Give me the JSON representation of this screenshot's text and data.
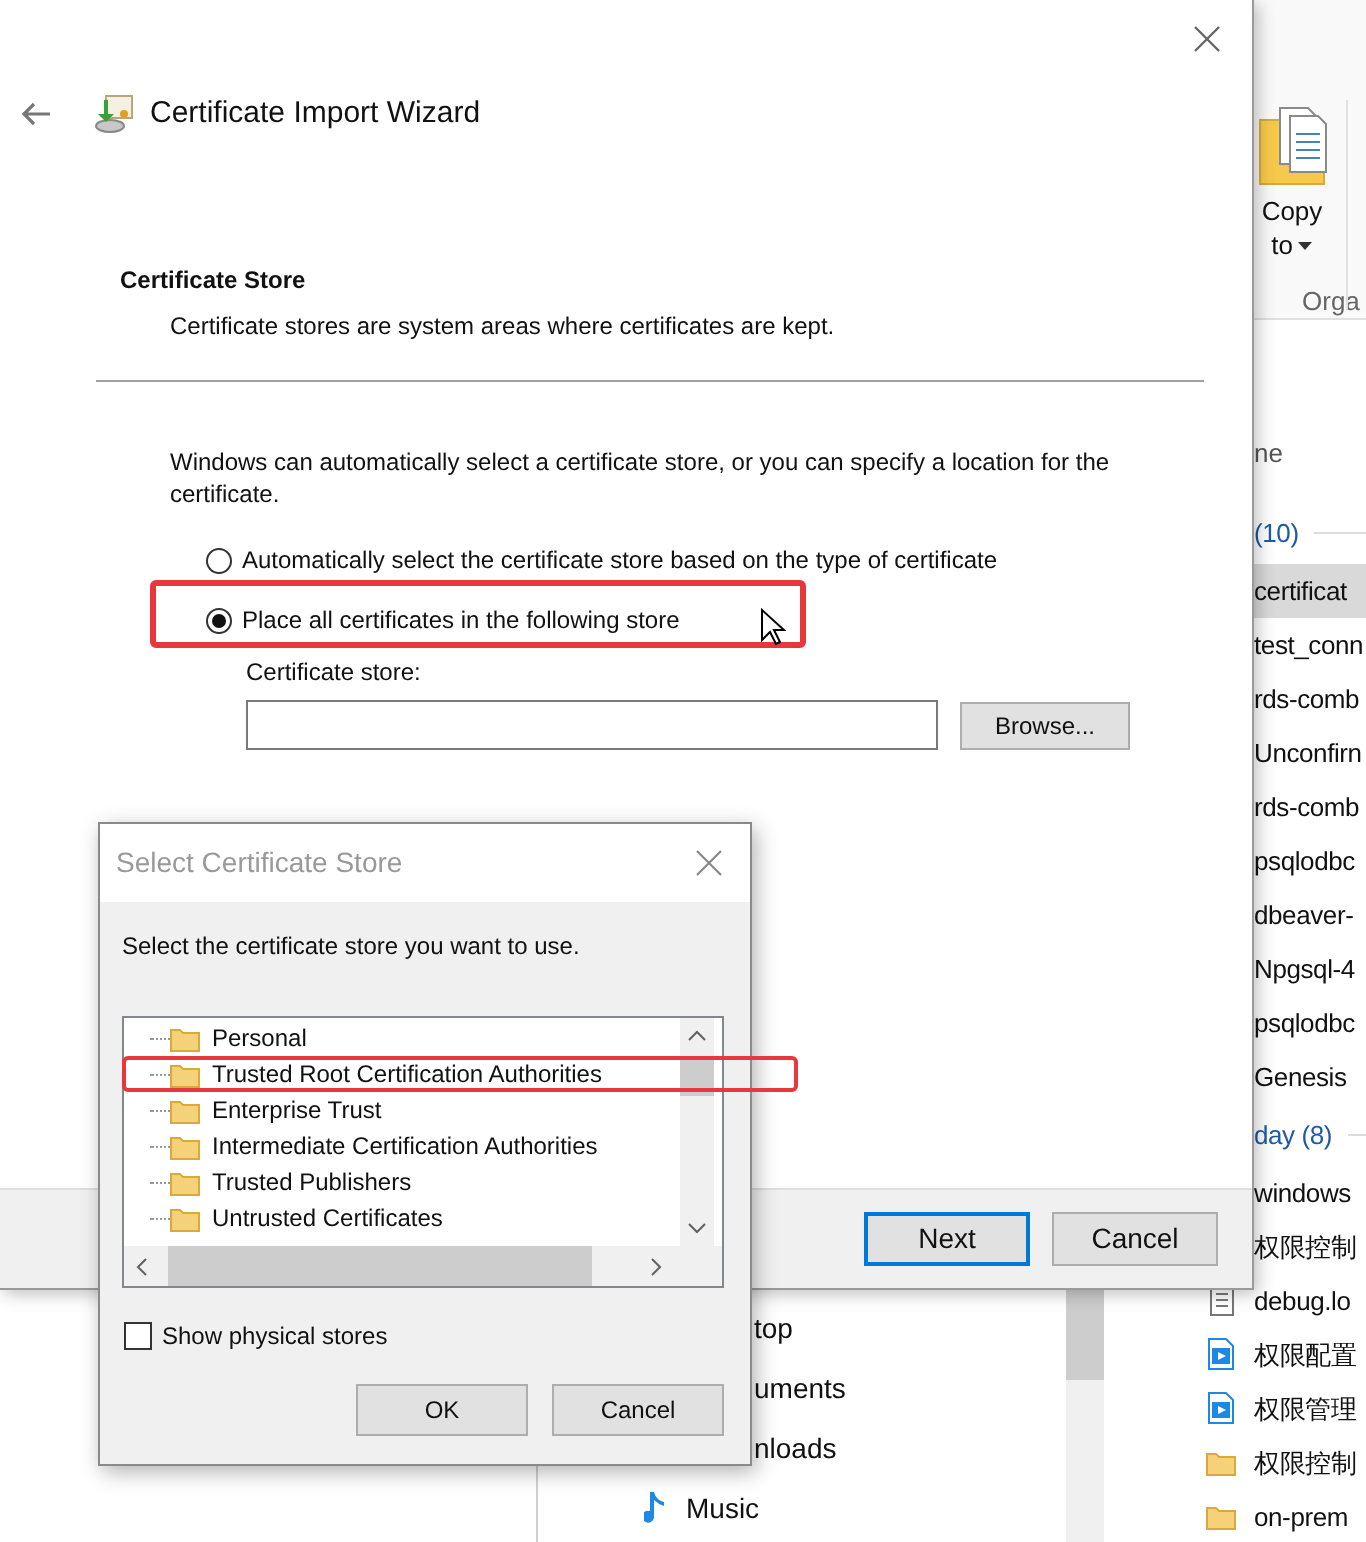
{
  "explorer": {
    "ribbon": {
      "button_lines": [
        "Copy",
        "to"
      ],
      "group_label": "Orga"
    },
    "column_header": "ne",
    "files": [
      {
        "kind": "group",
        "name": "(10)",
        "selected": false
      },
      {
        "kind": "file",
        "name": "certificat",
        "selected": true
      },
      {
        "kind": "file",
        "name": "test_conn",
        "selected": false
      },
      {
        "kind": "file",
        "name": "rds-comb",
        "selected": false
      },
      {
        "kind": "file",
        "name": "Unconfirn",
        "selected": false
      },
      {
        "kind": "file",
        "name": "rds-comb",
        "selected": false
      },
      {
        "kind": "file",
        "name": "psqlodbc",
        "selected": false
      },
      {
        "kind": "file",
        "name": "dbeaver-",
        "selected": false
      },
      {
        "kind": "file",
        "name": "Npgsql-4",
        "selected": false
      },
      {
        "kind": "file",
        "name": "psqlodbc",
        "selected": false
      },
      {
        "kind": "file",
        "name": "Genesis",
        "selected": false
      },
      {
        "kind": "group",
        "name": "day (8)",
        "selected": false
      },
      {
        "kind": "file",
        "name": "windows",
        "selected": false
      },
      {
        "kind": "file",
        "name": "权限控制",
        "selected": false
      },
      {
        "kind": "text",
        "name": "debug.lo",
        "selected": false
      },
      {
        "kind": "video",
        "name": "权限配置",
        "selected": false
      },
      {
        "kind": "video",
        "name": "权限管理",
        "selected": false
      },
      {
        "kind": "folder",
        "name": "权限控制",
        "selected": false
      },
      {
        "kind": "folder",
        "name": "on-prem",
        "selected": false
      }
    ],
    "nav_items": [
      {
        "kind": "plain",
        "label": "top"
      },
      {
        "kind": "plain",
        "label": "uments"
      },
      {
        "kind": "plain",
        "label": "nloads"
      },
      {
        "kind": "music",
        "label": "Music"
      }
    ]
  },
  "wizard": {
    "title": "Certificate Import Wizard",
    "heading": "Certificate Store",
    "subheading": "Certificate stores are system areas where certificates are kept.",
    "description": "Windows can automatically select a certificate store, or you can specify a location for the certificate.",
    "radios": [
      {
        "label": "Automatically select the certificate store based on the type of certificate",
        "selected": false
      },
      {
        "label": "Place all certificates in the following store",
        "selected": true
      }
    ],
    "store_label": "Certificate store:",
    "browse_button": "Browse...",
    "buttons": [
      {
        "label": "Next",
        "default": true
      },
      {
        "label": "Cancel",
        "default": false
      }
    ]
  },
  "dialog": {
    "title": "Select Certificate Store",
    "prompt": "Select the certificate store you want to use.",
    "stores": [
      {
        "label": "Personal",
        "selected": false
      },
      {
        "label": "Trusted Root Certification Authorities",
        "selected": false
      },
      {
        "label": "Enterprise Trust",
        "selected": false
      },
      {
        "label": "Intermediate Certification Authorities",
        "selected": false
      },
      {
        "label": "Trusted Publishers",
        "selected": false
      },
      {
        "label": "Untrusted Certificates",
        "selected": false
      }
    ],
    "show_physical": {
      "label": "Show physical stores",
      "checked": false
    },
    "buttons": [
      {
        "label": "OK"
      },
      {
        "label": "Cancel"
      }
    ]
  }
}
